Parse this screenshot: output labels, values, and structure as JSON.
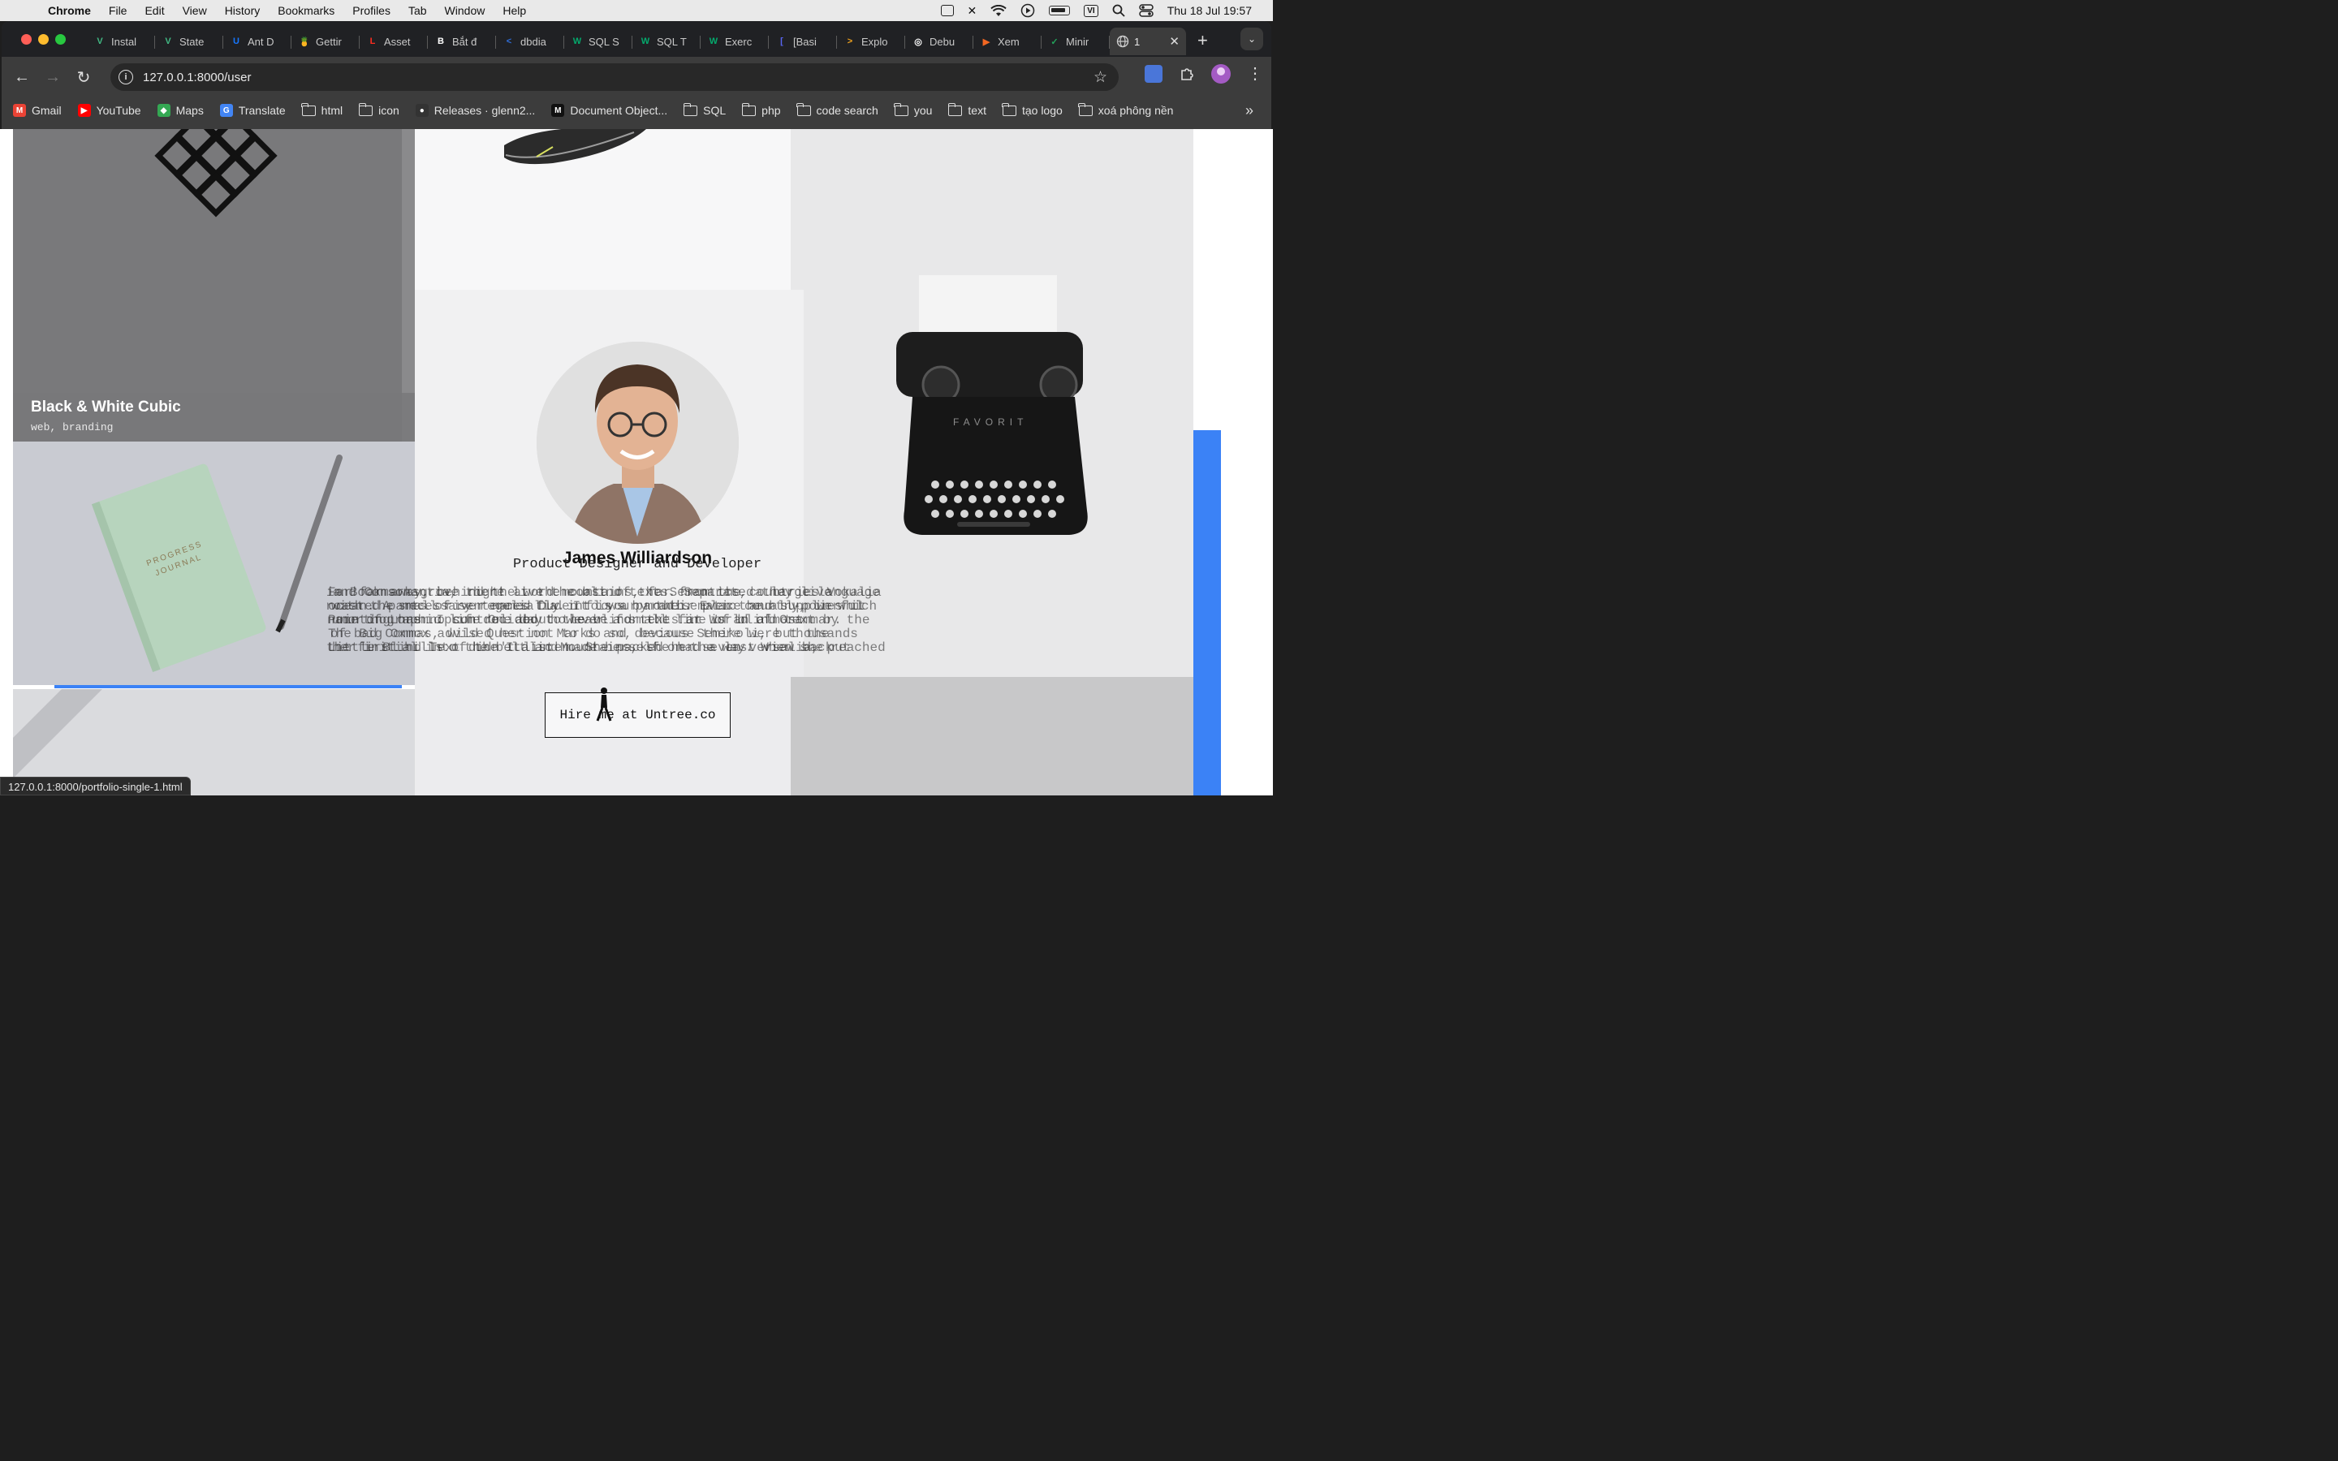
{
  "menubar": {
    "app": "Chrome",
    "items": [
      "File",
      "Edit",
      "View",
      "History",
      "Bookmarks",
      "Profiles",
      "Tab",
      "Window",
      "Help"
    ],
    "input_source": "VI",
    "clock": "Thu 18 Jul  19:57"
  },
  "tabs": [
    {
      "label": "Instal",
      "icon": "V",
      "color": "#41b883"
    },
    {
      "label": "State",
      "icon": "V",
      "color": "#41b883"
    },
    {
      "label": "Ant D",
      "icon": "U",
      "color": "#1677ff"
    },
    {
      "label": "Gettir",
      "icon": "🍍",
      "color": "#3c3c3c"
    },
    {
      "label": "Asset",
      "icon": "L",
      "color": "#ff2d20"
    },
    {
      "label": "Bắt đ",
      "icon": "B",
      "color": "#ffffff"
    },
    {
      "label": "dbdia",
      "icon": "<",
      "color": "#2f6fdc"
    },
    {
      "label": "SQL S",
      "icon": "W",
      "color": "#04aa6d"
    },
    {
      "label": "SQL T",
      "icon": "W",
      "color": "#04aa6d"
    },
    {
      "label": "Exerc",
      "icon": "W",
      "color": "#04aa6d"
    },
    {
      "label": "[Basi",
      "icon": "[",
      "color": "#5865f2"
    },
    {
      "label": "Explo",
      "icon": ">",
      "color": "#f2a41e"
    },
    {
      "label": "Debu",
      "icon": "◎",
      "color": "#ffffff"
    },
    {
      "label": "Xem",
      "icon": "▶",
      "color": "#f26722"
    },
    {
      "label": "Minir",
      "icon": "✓",
      "color": "#22a35a"
    }
  ],
  "active_tab": {
    "label": "1"
  },
  "address": {
    "url": "127.0.0.1:8000/user"
  },
  "bookmarks": [
    {
      "label": "Gmail",
      "type": "site",
      "icon": "M",
      "color": "#ea4335"
    },
    {
      "label": "YouTube",
      "type": "site",
      "icon": "▶",
      "color": "#ff0000"
    },
    {
      "label": "Maps",
      "type": "site",
      "icon": "◆",
      "color": "#34a853"
    },
    {
      "label": "Translate",
      "type": "site",
      "icon": "G",
      "color": "#4285f4"
    },
    {
      "label": "html",
      "type": "folder"
    },
    {
      "label": "icon",
      "type": "folder"
    },
    {
      "label": "Releases · glenn2...",
      "type": "site",
      "icon": "●",
      "color": "#333333"
    },
    {
      "label": "Document Object...",
      "type": "site",
      "icon": "M",
      "color": "#111111"
    },
    {
      "label": "SQL",
      "type": "folder"
    },
    {
      "label": "php",
      "type": "folder"
    },
    {
      "label": "code search",
      "type": "folder"
    },
    {
      "label": "you",
      "type": "folder"
    },
    {
      "label": "text",
      "type": "folder"
    },
    {
      "label": "tạo logo",
      "type": "folder"
    },
    {
      "label": "xoá phông nền",
      "type": "folder"
    }
  ],
  "page": {
    "portfolio_item": {
      "title": "Black & White Cubic",
      "tags": "web, branding"
    },
    "profile": {
      "name": "James Williardson",
      "role": "Product Designer and Developer",
      "bio_lines": [
        "Far far away, behind the word mountains, far from the countries Vokalia",
        "and Consonantia, there live the blind texts. Separated they live",
        "in Bookmarksgrove right at the coast of the Semantics, a large language",
        "ocean. A small river named Duden flows by their place and supplies it",
        "with the necessary regelialia. It is a paradisematic country, in which",
        "roasted parts of sentences fly into your mouth. Even the all-powerful",
        "Pointing has no control about the blind texts it is an almost",
        "unorthographic life One day however a small line of blind text by the",
        "name of Lorem Ipsum decided to leave for the far World of Grammar.",
        "The Big Oxmox advised her not to do so, because there were thousands",
        "of bad Commas, wild Question Marks and devious Semikoli, but the",
        "Little Blind Text didn't listen. She packed her seven versalia, put",
        "her initial into the belt and made herself on the way. When she reached",
        "the first hills of the Italic Mountains, she had a last view back"
      ],
      "hire_button": "Hire me at Untree.co"
    },
    "notebook_text": [
      "PROGRESS",
      "JOURNAL"
    ],
    "typewriter_brand": "FAVORIT",
    "accent": "#3b82f6"
  },
  "status_bar": {
    "hover_url": "127.0.0.1:8000/portfolio-single-1.html"
  }
}
